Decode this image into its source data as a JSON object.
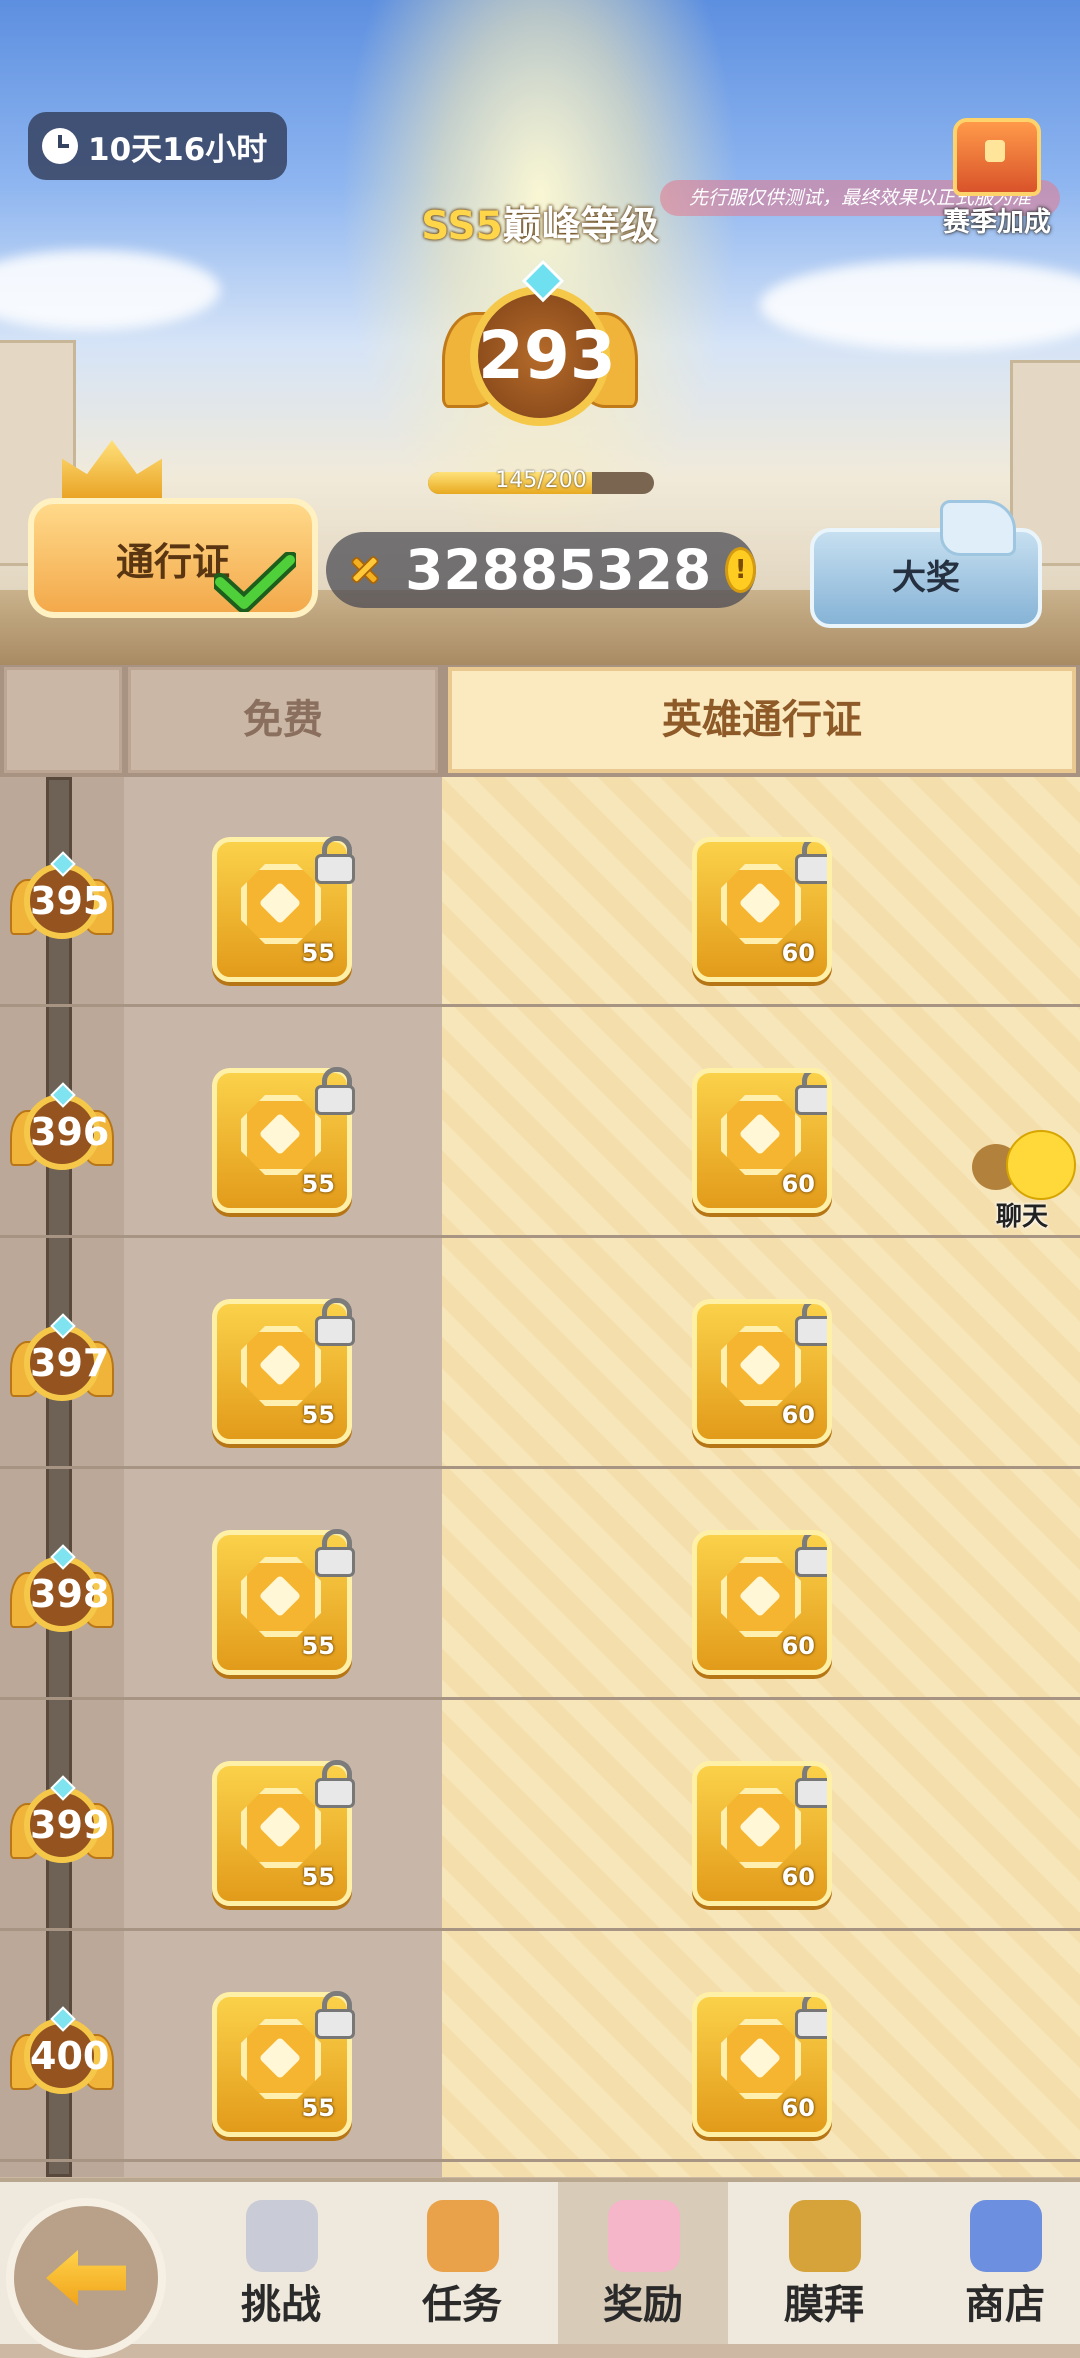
{
  "header": {
    "timer": "10天16小时",
    "notice": "先行服仅供测试，最终效果以正式服为准",
    "season_bonus_label": "赛季加成",
    "season_prefix": "SS5",
    "level_title": "巅峰等级",
    "peak_level": "293",
    "xp_text": "145/200",
    "xp_progress": 0.725,
    "pass_button": "通行证",
    "pass_owned": true,
    "currency_amount": "32885328",
    "grand_prize_button": "大奖"
  },
  "table": {
    "col_free": "免费",
    "col_hero": "英雄通行证",
    "rows": [
      {
        "level": "395",
        "free_qty": "55",
        "hero_qty": "60"
      },
      {
        "level": "396",
        "free_qty": "55",
        "hero_qty": "60"
      },
      {
        "level": "397",
        "free_qty": "55",
        "hero_qty": "60"
      },
      {
        "level": "398",
        "free_qty": "55",
        "hero_qty": "60"
      },
      {
        "level": "399",
        "free_qty": "55",
        "hero_qty": "60"
      },
      {
        "level": "400",
        "free_qty": "55",
        "hero_qty": "60"
      }
    ]
  },
  "chat": {
    "label": "聊天"
  },
  "nav": {
    "tabs": [
      {
        "label": "挑战",
        "icon": "challenge-icon"
      },
      {
        "label": "任务",
        "icon": "task-icon"
      },
      {
        "label": "奖励",
        "icon": "reward-icon",
        "active": true
      },
      {
        "label": "膜拜",
        "icon": "worship-icon"
      },
      {
        "label": "商店",
        "icon": "shop-icon"
      }
    ]
  },
  "colors": {
    "gold": "#f5c84a",
    "hero_bg": "#f8e6bb",
    "free_bg": "#c8b7a9"
  }
}
